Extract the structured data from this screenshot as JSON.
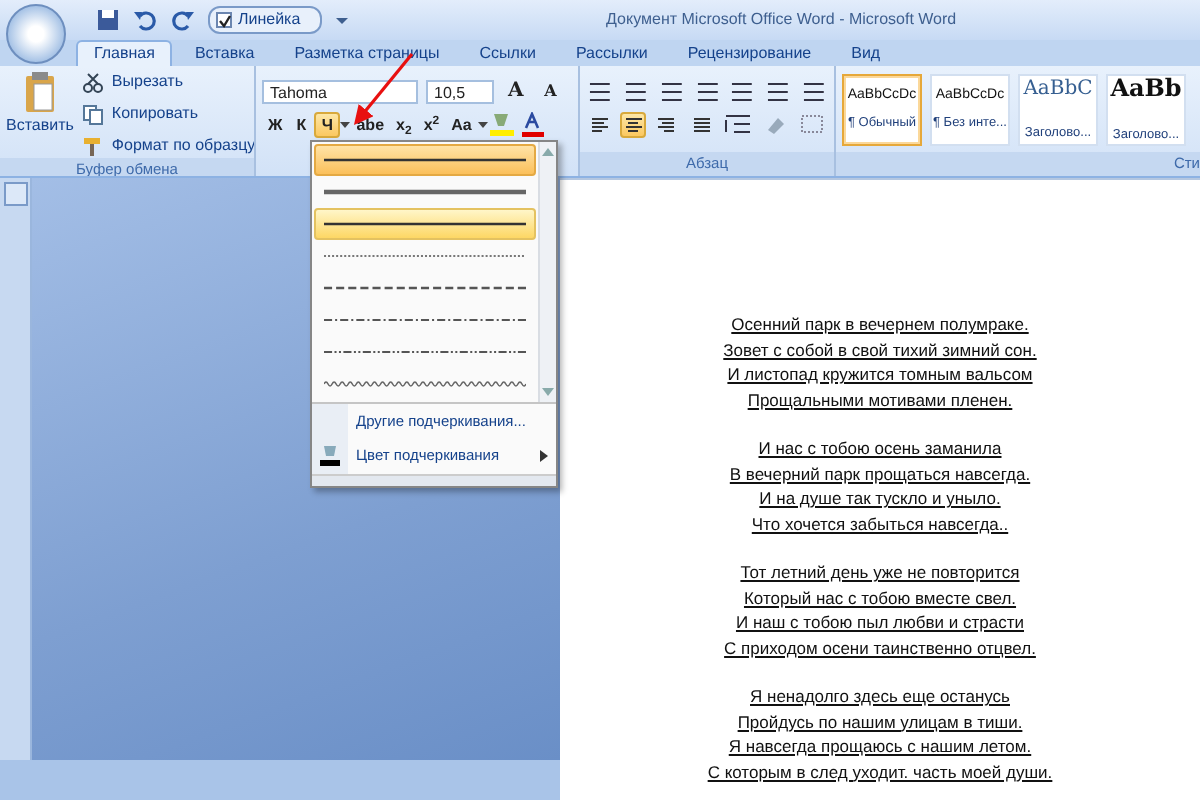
{
  "window": {
    "title": "Документ Microsoft Office Word - Microsoft Word"
  },
  "quick_access": {
    "ruler_label": "Линейка",
    "ruler_checked": true
  },
  "tabs": [
    {
      "label": "Главная",
      "selected": true
    },
    {
      "label": "Вставка",
      "selected": false
    },
    {
      "label": "Разметка страницы",
      "selected": false
    },
    {
      "label": "Ссылки",
      "selected": false
    },
    {
      "label": "Рассылки",
      "selected": false
    },
    {
      "label": "Рецензирование",
      "selected": false
    },
    {
      "label": "Вид",
      "selected": false
    }
  ],
  "clipboard": {
    "paste": "Вставить",
    "cut": "Вырезать",
    "copy": "Копировать",
    "format_painter": "Формат по образцу",
    "group_label": "Буфер обмена"
  },
  "font": {
    "font_name": "Tahoma",
    "font_size": "10,5",
    "grow": "A",
    "shrink": "A",
    "format_buttons": [
      {
        "label": "Ж",
        "kind": "plain",
        "selected": false
      },
      {
        "label": "К",
        "kind": "plain",
        "selected": false
      },
      {
        "label": "Ч",
        "kind": "split",
        "selected": true
      },
      {
        "label": "abe",
        "kind": "plain",
        "selected": false
      },
      {
        "label": "x$_{2}$",
        "kind": "plain",
        "selected": false
      },
      {
        "label": "x$^{2}$",
        "kind": "plain",
        "selected": false
      },
      {
        "label": "Aa",
        "kind": "split",
        "selected": false
      }
    ]
  },
  "paragraph": {
    "group_label": "Абзац",
    "alignment_buttons": [
      {
        "kind": "left",
        "selected": false
      },
      {
        "kind": "center",
        "selected": true
      },
      {
        "kind": "right",
        "selected": false
      },
      {
        "kind": "justify",
        "selected": false
      }
    ]
  },
  "styles": {
    "group_label": "Сти",
    "tiles": [
      {
        "sample": "AaBbCcDc",
        "name": "¶ Обычный",
        "kind": "normal",
        "selected": true
      },
      {
        "sample": "AaBbCcDc",
        "name": "¶ Без инте...",
        "kind": "normal",
        "selected": false
      },
      {
        "sample": "AaBbC",
        "name": "Заголово...",
        "kind": "heading1",
        "selected": false
      },
      {
        "sample": "AaBb",
        "name": "Заголово...",
        "kind": "heading2",
        "selected": false
      }
    ]
  },
  "underline_menu": {
    "styles": [
      {
        "kind": "solid",
        "hovered": true,
        "selected": false
      },
      {
        "kind": "thick",
        "hovered": false,
        "selected": false
      },
      {
        "kind": "solid",
        "hovered": false,
        "selected": true
      },
      {
        "kind": "dotted",
        "hovered": false,
        "selected": false
      },
      {
        "kind": "dashed",
        "hovered": false,
        "selected": false
      },
      {
        "kind": "dashdot",
        "hovered": false,
        "selected": false
      },
      {
        "kind": "dashdotdot",
        "hovered": false,
        "selected": false
      },
      {
        "kind": "wavy",
        "hovered": false,
        "selected": false
      }
    ],
    "items": [
      {
        "label": "Другие подчеркивания...",
        "submenu": false
      },
      {
        "label": "Цвет подчеркивания",
        "submenu": true
      }
    ]
  },
  "document": {
    "stanzas": [
      [
        "Осенний парк в вечернем полумраке.",
        "Зовет с собой в свой тихий зимний сон.",
        "И листопад кружится томным вальсом",
        "Прощальными мотивами пленен."
      ],
      [
        "И нас с тобою осень заманила",
        "В вечерний парк прощаться навсегда.",
        "И на душе так тускло и уныло.",
        "Что хочется забыться навсегда.."
      ],
      [
        "Тот летний день уже не повторится",
        "Который нас с тобою вместе свел.",
        "И наш с тобою пыл любви и страсти",
        "С приходом осени таинственно отцвел."
      ],
      [
        "Я ненадолго здесь еще останусь",
        "Пройдусь по нашим улицам в тиши.",
        "Я навсегда прощаюсь с нашим летом.",
        "С которым в след уходит. часть моей души."
      ]
    ]
  }
}
